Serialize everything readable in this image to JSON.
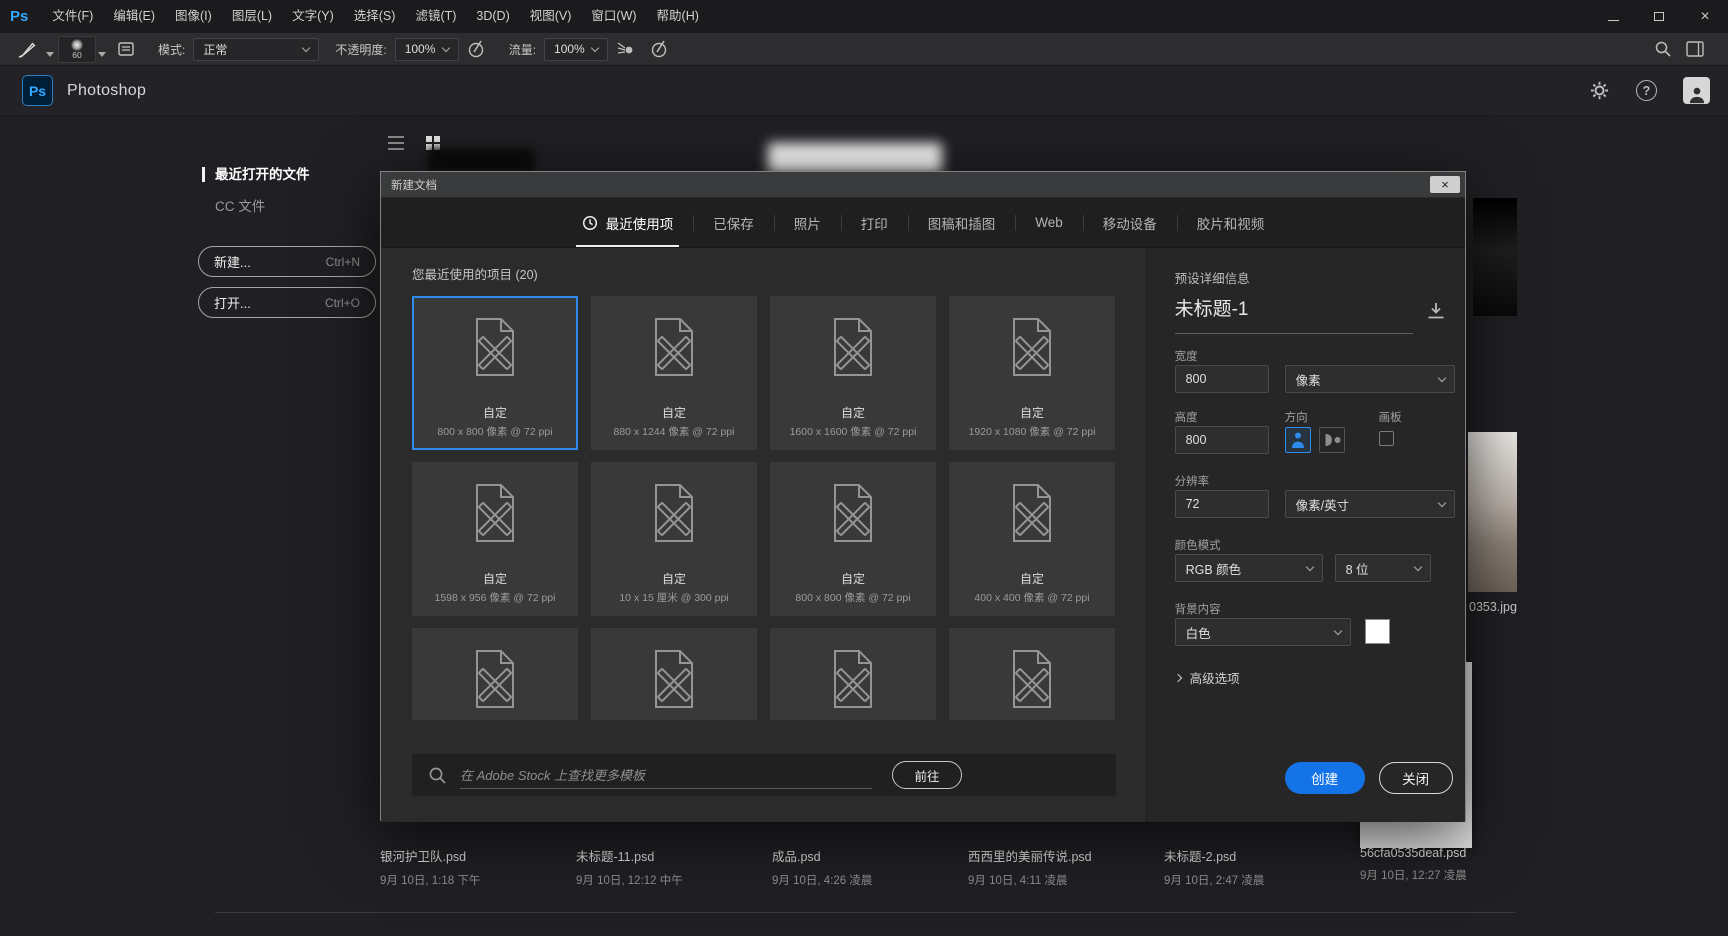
{
  "colors": {
    "accent": "#1473e6",
    "selection": "#2d8ceb",
    "swatch_background": "#ffffff"
  },
  "menubar": {
    "logo": "Ps",
    "items": [
      "文件(F)",
      "编辑(E)",
      "图像(I)",
      "图层(L)",
      "文字(Y)",
      "选择(S)",
      "滤镜(T)",
      "3D(D)",
      "视图(V)",
      "窗口(W)",
      "帮助(H)"
    ]
  },
  "toolbar": {
    "brush_size": "60",
    "mode_label": "模式:",
    "mode_value": "正常",
    "opacity_label": "不透明度:",
    "opacity_value": "100%",
    "flow_label": "流量:",
    "flow_value": "100%"
  },
  "home": {
    "header": {
      "logo": "Ps",
      "title": "Photoshop"
    },
    "sidebar": {
      "items": [
        {
          "label": "最近打开的文件",
          "active": true
        },
        {
          "label": "CC 文件",
          "active": false
        }
      ],
      "buttons": [
        {
          "label": "新建...",
          "shortcut": "Ctrl+N"
        },
        {
          "label": "打开...",
          "shortcut": "Ctrl+O"
        }
      ]
    },
    "side_thumb_label": "0353.jpg",
    "recent_files": [
      {
        "name": "银河护卫队.psd",
        "date": "9月 10日, 1:18 下午"
      },
      {
        "name": "未标题-11.psd",
        "date": "9月 10日, 12:12 中午"
      },
      {
        "name": "成品.psd",
        "date": "9月 10日, 4:26 凌晨"
      },
      {
        "name": "西西里的美丽传说.psd",
        "date": "9月 10日, 4:11 凌晨"
      },
      {
        "name": "未标题-2.psd",
        "date": "9月 10日, 2:47 凌晨"
      },
      {
        "name": "56cfa0535deaf.psd",
        "date": "9月 10日, 12:27 凌晨"
      }
    ]
  },
  "dialog": {
    "title": "新建文档",
    "tabs": [
      {
        "label": "最近使用项",
        "active": true
      },
      {
        "label": "已保存",
        "active": false
      },
      {
        "label": "照片",
        "active": false
      },
      {
        "label": "打印",
        "active": false
      },
      {
        "label": "图稿和插图",
        "active": false
      },
      {
        "label": "Web",
        "active": false
      },
      {
        "label": "移动设备",
        "active": false
      },
      {
        "label": "胶片和视频",
        "active": false
      }
    ],
    "section_title": "您最近使用的项目  (20)",
    "templates": [
      {
        "name": "自定",
        "desc": "800 x 800 像素 @ 72 ppi",
        "selected": true
      },
      {
        "name": "自定",
        "desc": "880 x 1244 像素 @ 72 ppi",
        "selected": false
      },
      {
        "name": "自定",
        "desc": "1600 x 1600 像素 @ 72 ppi",
        "selected": false
      },
      {
        "name": "自定",
        "desc": "1920 x 1080 像素 @ 72 ppi",
        "selected": false
      },
      {
        "name": "自定",
        "desc": "1598 x 956 像素 @ 72 ppi",
        "selected": false
      },
      {
        "name": "自定",
        "desc": "10 x 15 厘米 @ 300 ppi",
        "selected": false
      },
      {
        "name": "自定",
        "desc": "800 x 800 像素 @ 72 ppi",
        "selected": false
      },
      {
        "name": "自定",
        "desc": "400 x 400 像素 @ 72 ppi",
        "selected": false
      },
      {
        "name": "",
        "desc": "",
        "selected": false
      },
      {
        "name": "",
        "desc": "",
        "selected": false
      },
      {
        "name": "",
        "desc": "",
        "selected": false
      },
      {
        "name": "",
        "desc": "",
        "selected": false
      }
    ],
    "search": {
      "placeholder": "在 Adobe Stock 上查找更多模板",
      "go_label": "前往"
    },
    "preset": {
      "title": "预设详细信息",
      "name": "未标题-1",
      "width_label": "宽度",
      "width_value": "800",
      "width_unit": "像素",
      "height_label": "高度",
      "height_value": "800",
      "orientation_label": "方向",
      "artboard_label": "画板",
      "resolution_label": "分辨率",
      "resolution_value": "72",
      "resolution_unit": "像素/英寸",
      "color_mode_label": "颜色模式",
      "color_mode_value": "RGB 颜色",
      "bit_depth_value": "8 位",
      "background_label": "背景内容",
      "background_value": "白色",
      "advanced_label": "高级选项",
      "create_label": "创建",
      "close_label": "关闭"
    }
  }
}
